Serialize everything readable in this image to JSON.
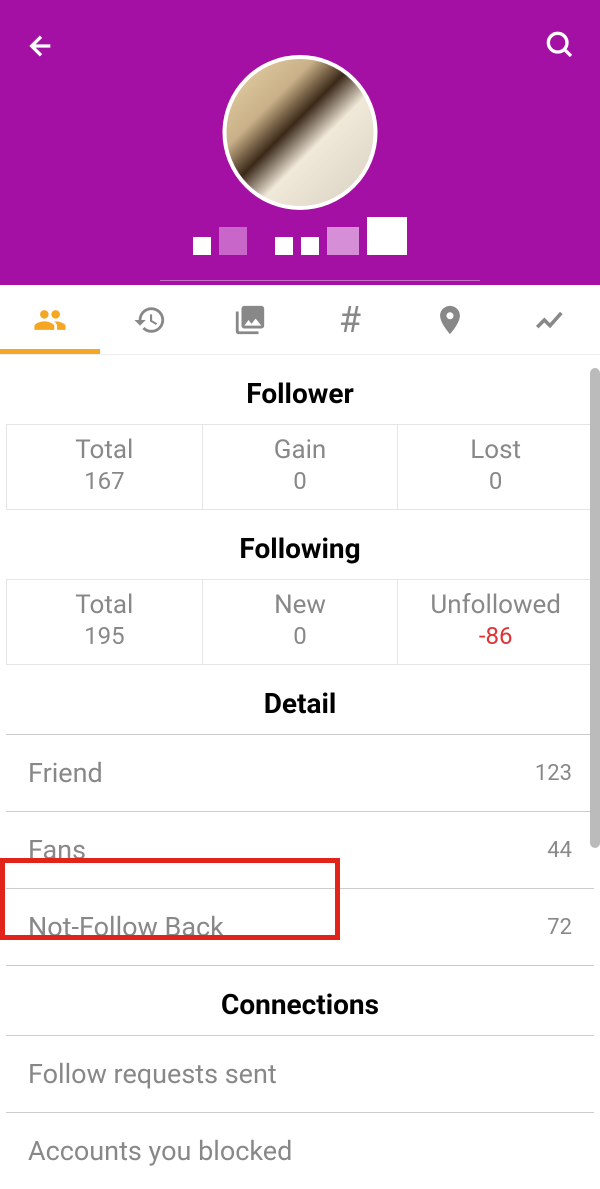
{
  "header": {
    "back_icon": "arrow-back",
    "search_icon": "search"
  },
  "tabs": [
    {
      "name": "people",
      "active": true
    },
    {
      "name": "history",
      "active": false
    },
    {
      "name": "photos",
      "active": false
    },
    {
      "name": "hashtag",
      "active": false
    },
    {
      "name": "location",
      "active": false
    },
    {
      "name": "trends",
      "active": false
    }
  ],
  "follower": {
    "title": "Follower",
    "cells": [
      {
        "label": "Total",
        "value": "167"
      },
      {
        "label": "Gain",
        "value": "0"
      },
      {
        "label": "Lost",
        "value": "0"
      }
    ]
  },
  "following": {
    "title": "Following",
    "cells": [
      {
        "label": "Total",
        "value": "195"
      },
      {
        "label": "New",
        "value": "0"
      },
      {
        "label": "Unfollowed",
        "value": "-86",
        "negative": true
      }
    ]
  },
  "detail": {
    "title": "Detail",
    "items": [
      {
        "label": "Friend",
        "value": "123"
      },
      {
        "label": "Fans",
        "value": "44"
      },
      {
        "label": "Not-Follow Back",
        "value": "72",
        "highlighted": true
      }
    ]
  },
  "connections": {
    "title": "Connections",
    "items": [
      {
        "label": "Follow requests sent"
      },
      {
        "label": "Accounts you blocked"
      }
    ]
  }
}
